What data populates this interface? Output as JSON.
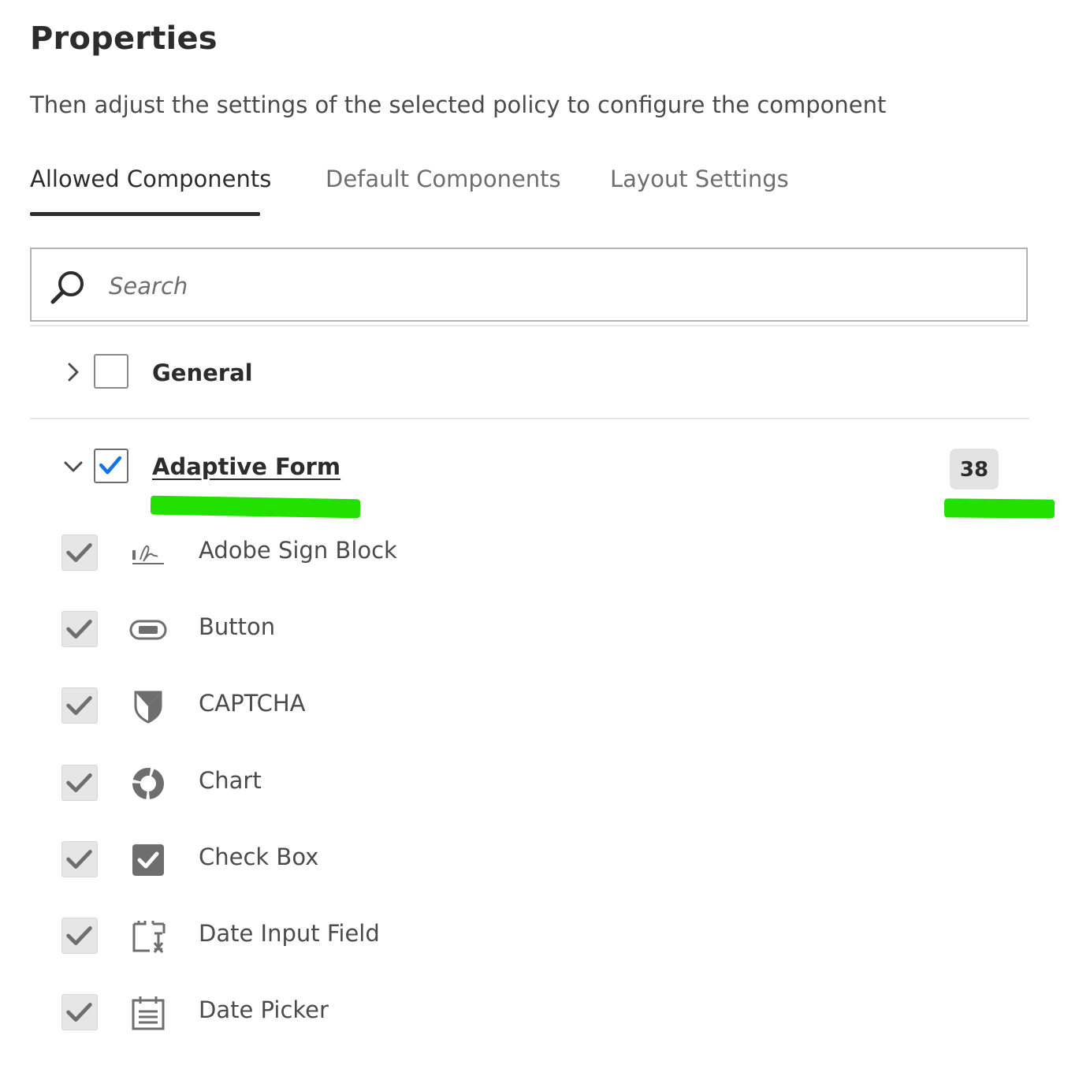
{
  "panel": {
    "title": "Properties",
    "subtitle": "Then adjust the settings of the selected policy to configure the component"
  },
  "tabs": [
    {
      "label": "Allowed Components",
      "active": true
    },
    {
      "label": "Default Components",
      "active": false
    },
    {
      "label": "Layout Settings",
      "active": false
    }
  ],
  "search": {
    "placeholder": "Search",
    "value": "",
    "icon": "search-icon"
  },
  "groups": [
    {
      "label": "General",
      "expanded": false,
      "checked": false,
      "icon": "chevron-right-icon"
    },
    {
      "label": "Adaptive Form",
      "expanded": true,
      "checked": true,
      "icon": "chevron-down-icon",
      "count": "38"
    }
  ],
  "items": [
    {
      "label": "Adobe Sign Block",
      "checked": true,
      "icon": "signature-icon"
    },
    {
      "label": "Button",
      "checked": true,
      "icon": "button-icon"
    },
    {
      "label": "CAPTCHA",
      "checked": true,
      "icon": "shield-icon"
    },
    {
      "label": "Chart",
      "checked": true,
      "icon": "chart-icon"
    },
    {
      "label": "Check Box",
      "checked": true,
      "icon": "checkbox-icon"
    },
    {
      "label": "Date Input Field",
      "checked": true,
      "icon": "date-input-icon"
    },
    {
      "label": "Date Picker",
      "checked": true,
      "icon": "calendar-icon"
    }
  ],
  "colors": {
    "accent_check": "#1473e6",
    "highlight_marker": "#22e000",
    "text": "#2c2c2c",
    "muted": "#6e6e6e"
  }
}
